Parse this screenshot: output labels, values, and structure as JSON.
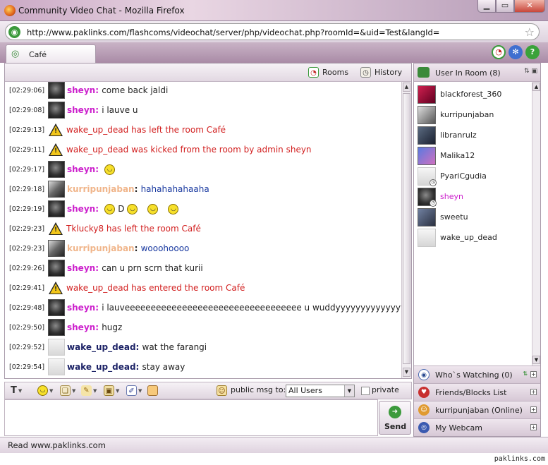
{
  "window": {
    "title": "Community Video Chat - Mozilla Firefox"
  },
  "browser": {
    "url": "http://www.paklinks.com/flashcoms/videochat/server/php/videochat.php?roomId=&uid=Test&langId="
  },
  "room_tab": {
    "label": "Café"
  },
  "chat_toolbar": {
    "rooms_label": "Rooms",
    "history_label": "History"
  },
  "messages": [
    {
      "time": "[02:29:06]",
      "user": "sheyn",
      "text": "come back jaldi"
    },
    {
      "time": "[02:29:08]",
      "user": "sheyn",
      "text": "i lauve u"
    },
    {
      "time": "[02:29:13]",
      "system": "wake_up_dead has left the room Café"
    },
    {
      "time": "[02:29:11]",
      "system": "wake_up_dead was kicked from the room by admin sheyn"
    },
    {
      "time": "[02:29:17]",
      "user": "sheyn",
      "text": ""
    },
    {
      "time": "[02:29:18]",
      "user": "kurripunjaban",
      "text": "hahahahahaaha"
    },
    {
      "time": "[02:29:19]",
      "user": "sheyn",
      "text": "D"
    },
    {
      "time": "[02:29:23]",
      "system": "Tklucky8 has left the room Café"
    },
    {
      "time": "[02:29:23]",
      "user": "kurripunjaban",
      "text": "wooohoooo"
    },
    {
      "time": "[02:29:26]",
      "user": "sheyn",
      "text": "can u prn scrn that kurii"
    },
    {
      "time": "[02:29:41]",
      "system": "wake_up_dead has entered the room Café"
    },
    {
      "time": "[02:29:48]",
      "user": "sheyn",
      "text": "i lauveeeeeeeeeeeeeeeeeeeeeeeeeeeeeeeeee u wuddyyyyyyyyyyyyyyyyyyy"
    },
    {
      "time": "[02:29:50]",
      "user": "sheyn",
      "text": "hugz"
    },
    {
      "time": "[02:29:52]",
      "user": "wake_up_dead",
      "text": "wat the farangi"
    },
    {
      "time": "[02:29:54]",
      "user": "wake_up_dead",
      "text": "stay away"
    }
  ],
  "sidebar": {
    "users_header": "User In Room (8)",
    "users": [
      "blackforest_360",
      "kurripunjaban",
      "libranrulz",
      "Malika12",
      "PyariCgudia",
      "sheyn",
      "sweetu",
      "wake_up_dead"
    ],
    "panels": [
      "Who`s Watching (0)",
      "Friends/Blocks List",
      "kurripunjaban (Online)",
      "My Webcam"
    ]
  },
  "input_bar": {
    "public_msg_label": "public msg to:",
    "recipient": "All Users",
    "private_label": "private",
    "send_label": "Send"
  },
  "status_bar": {
    "text": "Read www.paklinks.com"
  },
  "watermark": {
    "text": "paklinks.com"
  },
  "colors": {
    "admin_name": "#cc1fcc",
    "system_text": "#d22020",
    "guest_name": "#f0b58a",
    "user_name": "#1c2266"
  }
}
